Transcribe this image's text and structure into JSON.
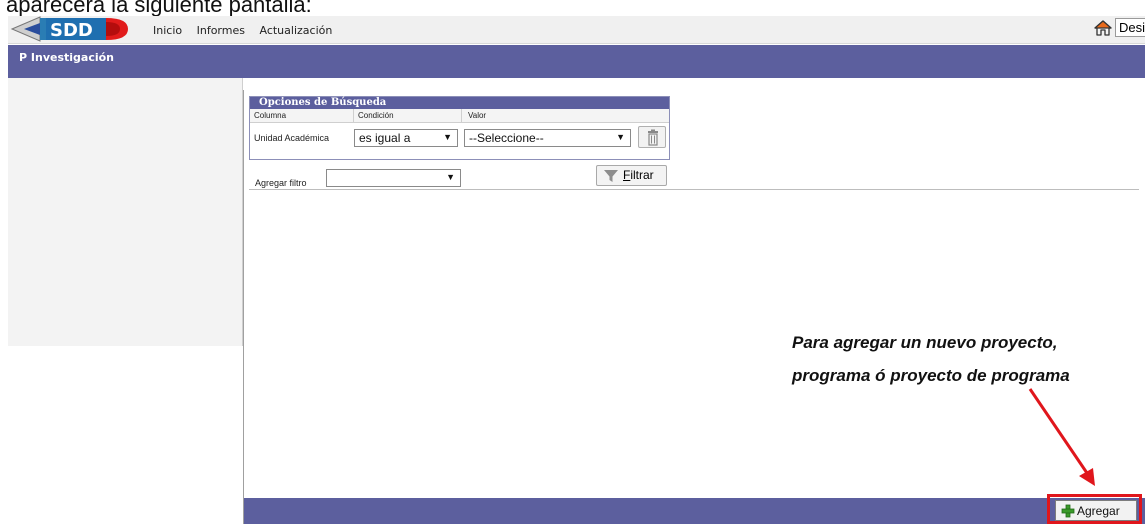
{
  "caption": "aparecerá la siguiente pantalla:",
  "app": {
    "logo_text": "SDD"
  },
  "menu": {
    "items": [
      "Inicio",
      "Informes",
      "Actualización"
    ]
  },
  "header": {
    "right_box": "Desig"
  },
  "page": {
    "title": "P Investigación"
  },
  "search": {
    "title": "Opciones de Búsqueda",
    "columns": [
      "Columna",
      "Condición",
      "Valor"
    ],
    "row": {
      "label": "Unidad Académica",
      "condition": "es igual a",
      "value": "--Seleccione--"
    },
    "add_filter_label": "Agregar filtro",
    "add_filter_value": "",
    "filter_button_prefix": "",
    "filter_button_underlined": "F",
    "filter_button_rest": "iltrar"
  },
  "annotation": {
    "line1": "Para agregar un nuevo proyecto,",
    "line2": "programa ó proyecto de programa"
  },
  "footer": {
    "add_button": "Agregar"
  },
  "colors": {
    "header_bar": "#5c5f9e",
    "highlight": "#e0161c"
  },
  "icons": [
    "sdd-logo-icon",
    "home-icon",
    "trash-icon",
    "filter-funnel-icon",
    "plus-icon",
    "pointer-arrow-icon"
  ]
}
